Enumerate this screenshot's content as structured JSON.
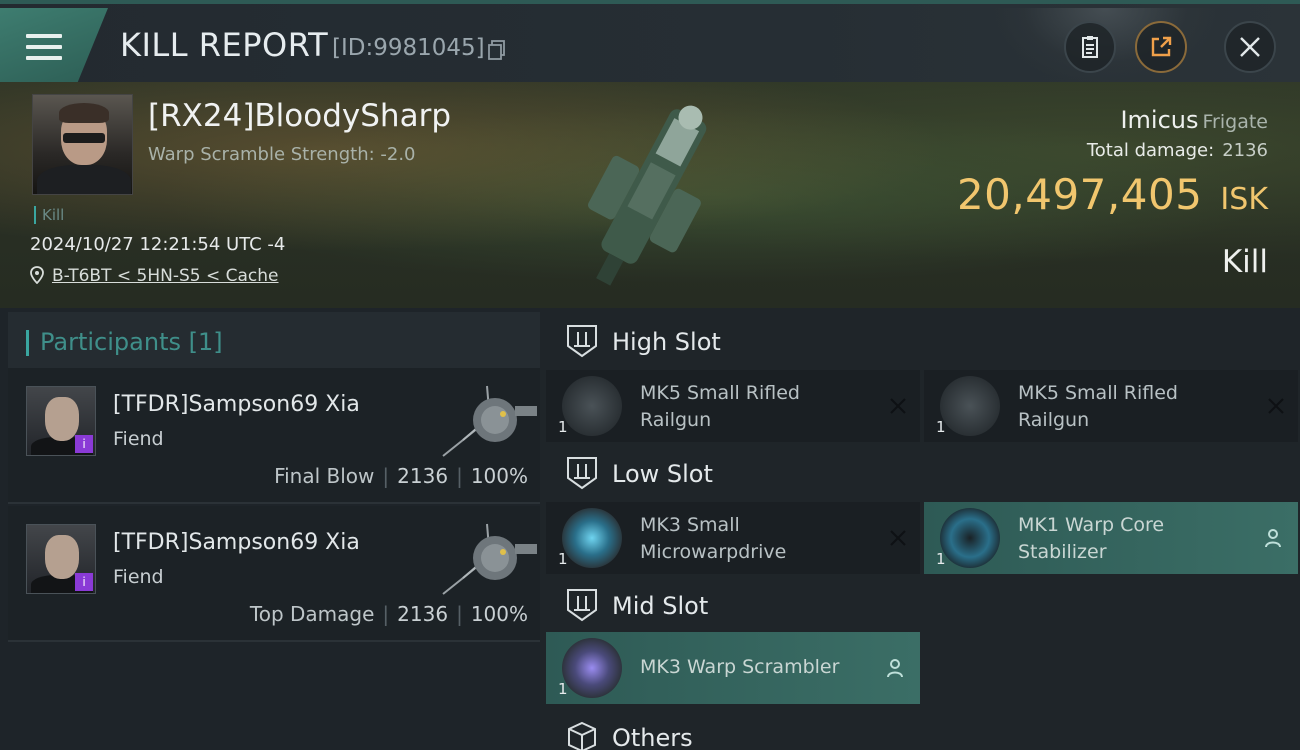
{
  "header": {
    "title": "KILL REPORT",
    "report_id": "[ID:9981045]"
  },
  "victim": {
    "name": "[RX24]BloodySharp",
    "warp_scramble": "Warp Scramble Strength: -2.0",
    "tag": "Kill",
    "timestamp": "2024/10/27 12:21:54 UTC -4",
    "location": "B-T6BT < 5HN-S5 < Cache"
  },
  "ship": {
    "name": "Imicus",
    "class": "Frigate",
    "total_damage_label": "Total damage:",
    "total_damage": "2136",
    "isk_value": "20,497,405",
    "isk_unit": "ISK",
    "result": "Kill"
  },
  "participants": {
    "header": "Participants [1]",
    "rows": [
      {
        "name": "[TFDR]Sampson69 Xia",
        "ship": "Fiend",
        "role": "Final Blow",
        "damage": "2136",
        "percent": "100%"
      },
      {
        "name": "[TFDR]Sampson69 Xia",
        "ship": "Fiend",
        "role": "Top Damage",
        "damage": "2136",
        "percent": "100%"
      }
    ]
  },
  "slots": {
    "high": {
      "label": "High Slot",
      "items": [
        {
          "name_line1": "MK5 Small Rifled",
          "name_line2": "Railgun",
          "qty": "1",
          "state": "destroyed"
        },
        {
          "name_line1": "MK5 Small Rifled",
          "name_line2": "Railgun",
          "qty": "1",
          "state": "destroyed"
        }
      ]
    },
    "low": {
      "label": "Low Slot",
      "items": [
        {
          "name_line1": "MK3 Small",
          "name_line2": "Microwarpdrive",
          "qty": "1",
          "state": "destroyed"
        },
        {
          "name_line1": "MK1 Warp Core",
          "name_line2": "Stabilizer",
          "qty": "1",
          "state": "dropped"
        }
      ]
    },
    "mid": {
      "label": "Mid Slot",
      "items": [
        {
          "name_line1": "MK3 Warp Scrambler",
          "qty": "1",
          "state": "dropped"
        }
      ]
    },
    "others": {
      "label": "Others"
    }
  },
  "colors": {
    "accent_teal": "#3aa6a0",
    "isk_gold": "#f1c66e",
    "dropped_item_bg": "#3b6e66"
  },
  "icons": [
    "menu-icon",
    "copy-icon",
    "clipboard-icon",
    "share-icon",
    "close-icon",
    "location-pin-icon",
    "slot-icon",
    "destroyed-x-icon",
    "owner-user-icon",
    "cube-icon"
  ]
}
